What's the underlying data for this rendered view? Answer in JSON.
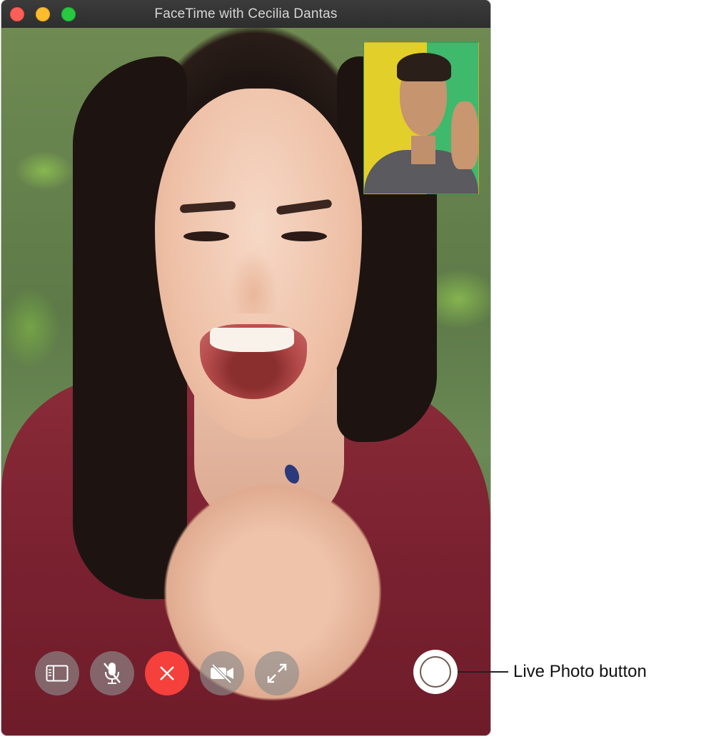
{
  "window": {
    "title": "FaceTime with Cecilia Dantas",
    "traffic_lights": {
      "close_color": "#fc5f57",
      "minimize_color": "#fdbc2e",
      "maximize_color": "#28c840"
    }
  },
  "video": {
    "remote": {
      "description_icon": "remote-video"
    },
    "self_view": {
      "description_icon": "self-view-video"
    }
  },
  "controls": [
    {
      "id": "sidebar",
      "icon": "sidebar-icon"
    },
    {
      "id": "mute",
      "icon": "microphone-muted-icon"
    },
    {
      "id": "end",
      "icon": "close-icon",
      "color": "#f5403b"
    },
    {
      "id": "video-off",
      "icon": "video-off-icon"
    },
    {
      "id": "fullscreen",
      "icon": "expand-icon"
    }
  ],
  "live_photo": {
    "icon": "shutter-icon"
  },
  "callout": {
    "label": "Live Photo button"
  }
}
